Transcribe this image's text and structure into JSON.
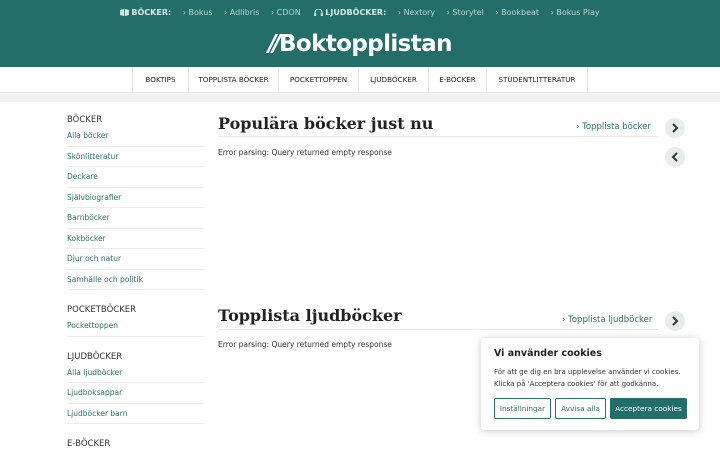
{
  "header": {
    "books_label": "BÖCKER:",
    "books_links": [
      "› Bokus",
      "› Adlibris",
      "› CDON"
    ],
    "audiobooks_label": "LJUDBÖCKER:",
    "audiobooks_links": [
      "› Nextory",
      "› Storytel",
      "› Bookbeat",
      "› Bokus Play"
    ],
    "logo_text": "Boktopplistan",
    "logo_mark": "//",
    "brand_color": "#236e68"
  },
  "nav": {
    "items": [
      "BOKTIPS",
      "TOPPLISTA BÖCKER",
      "POCKETTOPPEN",
      "LJUDBÖCKER",
      "E-BÖCKER",
      "STUDENTLITTERATUR"
    ]
  },
  "sidebar": {
    "groups": [
      {
        "heading": "BÖCKER",
        "items": [
          "Alla böcker",
          "Skönlitteratur",
          "Deckare",
          "Självbiografier",
          "Barnböcker",
          "Kokböcker",
          "Djur och natur",
          "Samhälle och politik"
        ]
      },
      {
        "heading": "POCKETBÖCKER",
        "items": [
          "Pockettoppen"
        ]
      },
      {
        "heading": "LJUDBÖCKER",
        "items": [
          "Alla ljudböcker",
          "Ljudboksappar",
          "Ljudböcker barn"
        ]
      },
      {
        "heading": "E-BÖCKER",
        "items": []
      }
    ]
  },
  "sections": [
    {
      "title": "Populära böcker just nu",
      "link": "› Topplista böcker",
      "error": "Error parsing: Query returned empty response"
    },
    {
      "title": "Topplista ljudböcker",
      "link": "› Topplista ljudböcker",
      "error": "Error parsing: Query returned empty response"
    }
  ],
  "icons": {
    "next": "chevron-right-icon",
    "prev": "chevron-left-icon",
    "books": "book-icon",
    "audio": "headphones-icon"
  },
  "cookie": {
    "title": "Vi använder cookies",
    "text": "För att ge dig en bra upplevelse använder vi cookies. Klicka på 'Acceptera cookies' för att godkänna.",
    "settings_label": "Inställningar",
    "reject_label": "Avvisa alla",
    "accept_label": "Acceptera cookies"
  }
}
